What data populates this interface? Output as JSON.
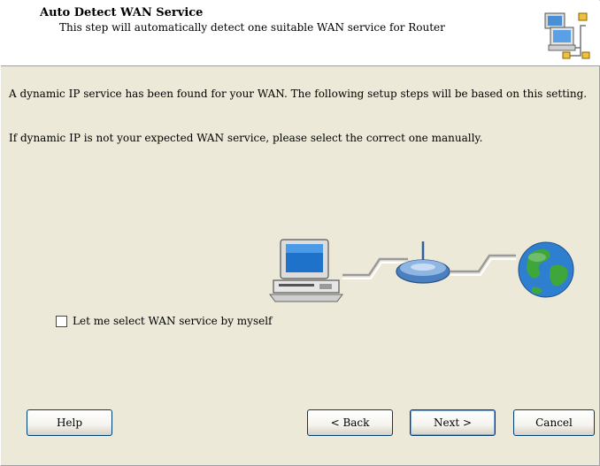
{
  "header": {
    "title": "Auto Detect WAN Service",
    "subtitle": "This step will automatically detect one suitable WAN service for Router",
    "icon": "network-computers-icon"
  },
  "content": {
    "paragraph1": "A dynamic IP service has been found for your WAN. The following setup steps will be based on this setting.",
    "paragraph2": "If dynamic IP is not your expected WAN service, please select the correct one manually.",
    "illustration": "computer-router-globe-illustration"
  },
  "checkbox": {
    "label": "Let me select WAN service by myself",
    "checked": false
  },
  "buttons": {
    "help": "Help",
    "back": "< Back",
    "next": "Next >",
    "cancel": "Cancel"
  },
  "colors": {
    "dialog_bg": "#ece9d8",
    "header_bg": "#ffffff",
    "button_border": "#003c74",
    "globe_water": "#2f7fd0",
    "globe_land": "#3fa63b"
  }
}
